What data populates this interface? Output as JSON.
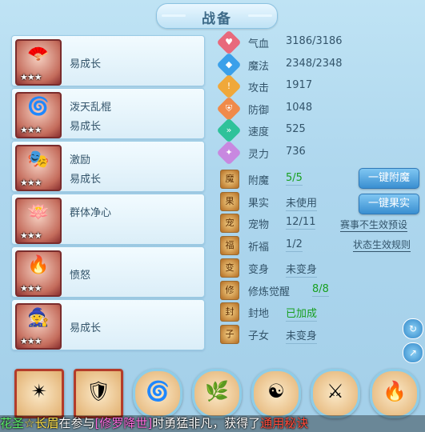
{
  "title": "战备",
  "skills": [
    {
      "name": "",
      "sub": "易成长",
      "glyph": "🪭",
      "stars": "★★★",
      "icon": "fan-skill-icon"
    },
    {
      "name": "泼天乱棍",
      "sub": "易成长",
      "glyph": "🌀",
      "stars": "★★★",
      "icon": "club-skill-icon"
    },
    {
      "name": "激励",
      "sub": "易成长",
      "glyph": "🎭",
      "stars": "★★★",
      "icon": "mask-skill-icon"
    },
    {
      "name": "群体净心",
      "sub": "",
      "glyph": "🪷",
      "stars": "★★★",
      "icon": "purify-skill-icon"
    },
    {
      "name": "",
      "sub": "愤怒",
      "glyph": "🔥",
      "stars": "★★★",
      "icon": "rage-skill-icon"
    },
    {
      "name": "",
      "sub": "易成长",
      "glyph": "🧙",
      "stars": "★★★",
      "icon": "figure-skill-icon"
    }
  ],
  "stats": [
    {
      "label": "气血",
      "value": "3186/3186",
      "color": "#e8697c",
      "symbol": "♥",
      "icon": "heart-icon"
    },
    {
      "label": "魔法",
      "value": "2348/2348",
      "color": "#3aa0ea",
      "symbol": "◆",
      "icon": "mana-icon"
    },
    {
      "label": "攻击",
      "value": "1917",
      "color": "#f0a83a",
      "symbol": "!",
      "icon": "attack-icon"
    },
    {
      "label": "防御",
      "value": "1048",
      "color": "#f08a4a",
      "symbol": "⛨",
      "icon": "defense-icon"
    },
    {
      "label": "速度",
      "value": "525",
      "color": "#2ec29a",
      "symbol": "»",
      "icon": "speed-icon"
    },
    {
      "label": "灵力",
      "value": "736",
      "color": "#c888e0",
      "symbol": "✦",
      "icon": "spirit-icon"
    }
  ],
  "props": [
    {
      "label": "附魔",
      "value": "5/5",
      "green": true,
      "symbol": "魔",
      "icon": "enchant-icon"
    },
    {
      "label": "果实",
      "value": "未使用",
      "green": false,
      "symbol": "果",
      "icon": "fruit-icon"
    },
    {
      "label": "宠物",
      "value": "12/11",
      "green": false,
      "symbol": "宠",
      "icon": "pet-icon"
    },
    {
      "label": "祈福",
      "value": "1/2",
      "green": false,
      "symbol": "福",
      "icon": "blessing-icon"
    },
    {
      "label": "变身",
      "value": "未变身",
      "green": false,
      "symbol": "变",
      "icon": "transform-icon"
    },
    {
      "label": "修炼觉醒",
      "value": "8/8",
      "green": true,
      "symbol": "修",
      "icon": "cultivate-icon"
    },
    {
      "label": "封地",
      "value": "已加成",
      "green": true,
      "symbol": "封",
      "icon": "fief-icon"
    },
    {
      "label": "子女",
      "value": "未变身",
      "green": false,
      "symbol": "子",
      "icon": "child-icon"
    }
  ],
  "buttons": {
    "enchant": "一键附魔",
    "fruit": "一键果实"
  },
  "links": {
    "preset": "赛事不生效预设",
    "rules": "状态生效规则"
  },
  "bottom_icons": [
    {
      "glyph": "✴",
      "shape": "square",
      "icon": "star-burst-icon"
    },
    {
      "glyph": "🛡",
      "shape": "square",
      "icon": "armor-icon"
    },
    {
      "glyph": "🌀",
      "shape": "round",
      "icon": "swirl-icon"
    },
    {
      "glyph": "🌿",
      "shape": "round",
      "icon": "herb-icon"
    },
    {
      "glyph": "☯",
      "shape": "round",
      "icon": "yin-yang-icon"
    },
    {
      "glyph": "⚔",
      "shape": "round",
      "icon": "warrior-icon"
    },
    {
      "glyph": "🔥",
      "shape": "round",
      "icon": "flame-icon"
    }
  ],
  "chat": {
    "part1": "花圣",
    "part2": "☆长眉",
    "part3": "在参与",
    "part4": "[修罗降世]",
    "part5": "时勇猛非凡，获得了",
    "part6": "通用秘诀"
  }
}
